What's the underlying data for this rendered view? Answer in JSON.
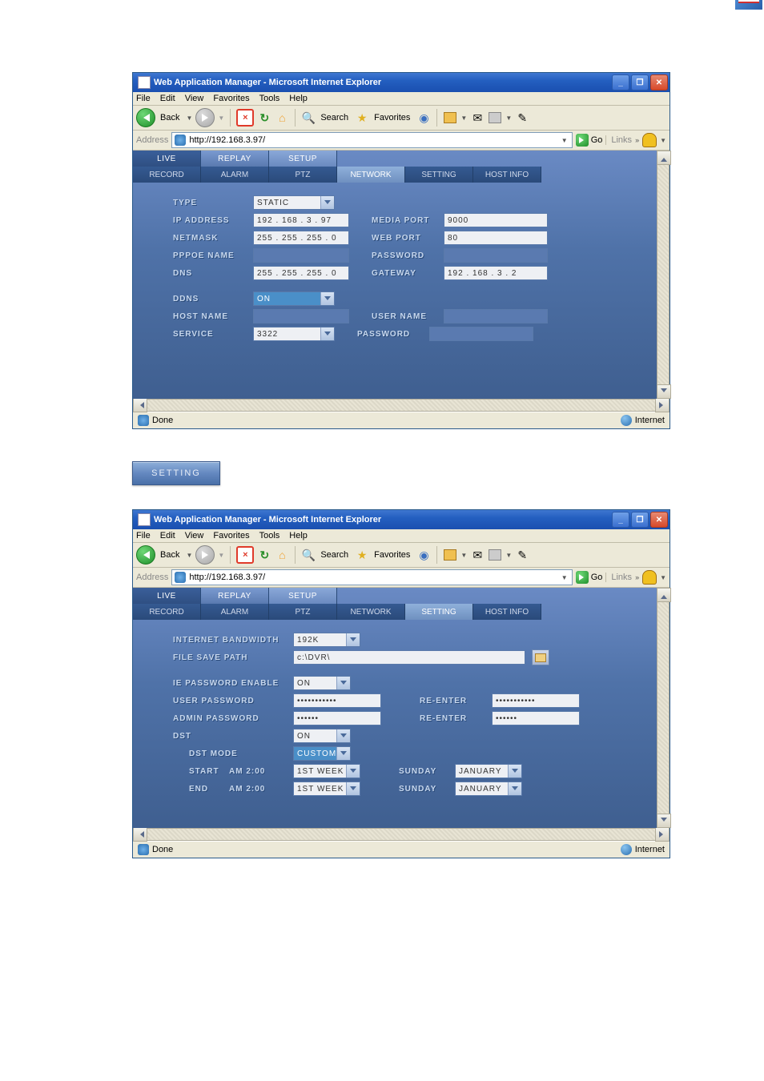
{
  "win": {
    "title": "Web Application Manager - Microsoft Internet Explorer",
    "menu": {
      "file": "File",
      "edit": "Edit",
      "view": "View",
      "favorites": "Favorites",
      "tools": "Tools",
      "help": "Help"
    },
    "toolbar": {
      "back": "Back",
      "search": "Search",
      "favorites": "Favorites"
    },
    "address_label": "Address",
    "url": "http://192.168.3.97/",
    "go": "Go",
    "links": "Links",
    "status_done": "Done",
    "status_zone": "Internet"
  },
  "tabs1": {
    "live": "LIVE",
    "replay": "REPLAY",
    "setup": "SETUP"
  },
  "tabs2": {
    "record": "RECORD",
    "alarm": "ALARM",
    "ptz": "PTZ",
    "network": "NETWORK",
    "setting": "SETTING",
    "hostinfo": "HOST INFO"
  },
  "network": {
    "labels": {
      "type": "TYPE",
      "ip": "IP ADDRESS",
      "netmask": "NETMASK",
      "pppoe": "PPPOE NAME",
      "dns": "DNS",
      "mediaport": "MEDIA PORT",
      "webport": "WEB PORT",
      "password": "PASSWORD",
      "gateway": "GATEWAY",
      "ddns": "DDNS",
      "hostname": "HOST NAME",
      "service": "SERVICE",
      "username": "USER NAME",
      "password2": "PASSWORD"
    },
    "values": {
      "type": "STATIC",
      "ip": "192 . 168 .  3  .  97",
      "netmask": "255 . 255 . 255 .  0",
      "dns": "255 . 255 . 255 .  0",
      "mediaport": "9000",
      "webport": "80",
      "gateway": "192 . 168 .  3  .  2",
      "pppoe": "",
      "password": "",
      "ddns": "ON",
      "hostname": "",
      "service": "3322",
      "username": "",
      "password2": ""
    }
  },
  "setting_chip": "SETTING",
  "setting": {
    "labels": {
      "ibw": "INTERNET BANDWIDTH",
      "fsp": "FILE SAVE PATH",
      "iepw": "IE PASSWORD ENABLE",
      "userpw": "USER PASSWORD",
      "adminpw": "ADMIN PASSWORD",
      "reenter": "RE-ENTER",
      "reenter2": "RE-ENTER",
      "dst": "DST",
      "dstmode": "DST MODE",
      "start": "START",
      "end": "END",
      "sunday": "SUNDAY",
      "sunday2": "SUNDAY"
    },
    "values": {
      "ibw": "192K",
      "fsp": "c:\\DVR\\",
      "iepw": "ON",
      "userpw": "•••••••••••",
      "adminpw": "••••••",
      "re1": "•••••••••••",
      "re2": "••••••",
      "dst": "ON",
      "dstmode": "CUSTOM",
      "start_time": "AM 2:00",
      "start_week": "1ST WEEK",
      "start_month": "JANUARY",
      "end_time": "AM 2:00",
      "end_week": "1ST WEEK",
      "end_month": "JANUARY"
    }
  }
}
